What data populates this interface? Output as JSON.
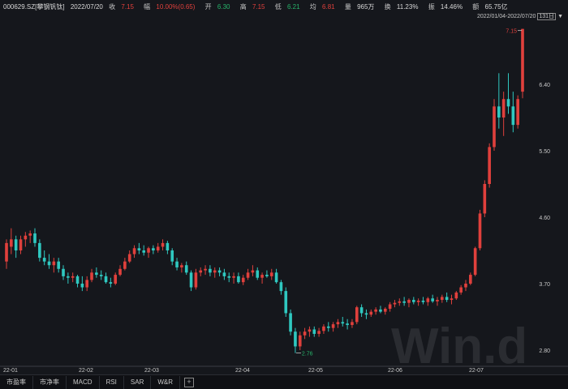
{
  "header": {
    "security": "000629.SZ[攀钢钒钛]",
    "date": "2022/07/20",
    "close_label": "收",
    "close": "7.15",
    "chg_label": "幅",
    "chg": "10.00%(0.65)",
    "open_label": "开",
    "open": "6.30",
    "high_label": "高",
    "high": "7.15",
    "low_label": "低",
    "low": "6.21",
    "prev_label": "均",
    "prev": "6.81",
    "vol_label": "量",
    "vol": "965万",
    "turn_label": "换",
    "turn": "11.23%",
    "amp_label": "振",
    "amp": "14.46%",
    "amt_label": "额",
    "amt": "65.75亿"
  },
  "range": {
    "text": "2022/01/04-2022/07/20",
    "count": "131日"
  },
  "watermark": "Win.d",
  "tabs": [
    "市盈率",
    "市净率",
    "MACD",
    "RSI",
    "SAR",
    "W&R"
  ],
  "tab_add": "+",
  "colors": {
    "up": "#e0403c",
    "down": "#2fc8c0",
    "bg": "#15171c"
  },
  "chart_data": {
    "type": "candlestick",
    "y_ticks": [
      "6.40",
      "5.50",
      "4.60",
      "3.70",
      "2.80"
    ],
    "x_ticks": [
      "22-01",
      "22-02",
      "22-03",
      "22-04",
      "22-05",
      "22-06",
      "22-07"
    ],
    "max_label": "7.15",
    "min_label": "2.76",
    "ohlc": [
      [
        4.0,
        4.3,
        3.9,
        4.25
      ],
      [
        4.2,
        4.45,
        4.1,
        4.3
      ],
      [
        4.3,
        4.35,
        4.05,
        4.15
      ],
      [
        4.15,
        4.35,
        4.1,
        4.3
      ],
      [
        4.3,
        4.4,
        4.2,
        4.35
      ],
      [
        4.35,
        4.42,
        4.25,
        4.38
      ],
      [
        4.38,
        4.45,
        4.2,
        4.25
      ],
      [
        4.25,
        4.3,
        4.0,
        4.05
      ],
      [
        4.05,
        4.15,
        3.95,
        4.0
      ],
      [
        4.0,
        4.1,
        3.9,
        3.95
      ],
      [
        3.95,
        4.05,
        3.85,
        4.0
      ],
      [
        4.0,
        4.05,
        3.85,
        3.9
      ],
      [
        3.9,
        3.95,
        3.75,
        3.8
      ],
      [
        3.8,
        3.85,
        3.7,
        3.78
      ],
      [
        3.78,
        3.85,
        3.72,
        3.8
      ],
      [
        3.8,
        3.82,
        3.65,
        3.7
      ],
      [
        3.7,
        3.8,
        3.6,
        3.65
      ],
      [
        3.65,
        3.8,
        3.6,
        3.75
      ],
      [
        3.75,
        3.9,
        3.72,
        3.85
      ],
      [
        3.85,
        3.92,
        3.78,
        3.82
      ],
      [
        3.82,
        3.88,
        3.75,
        3.8
      ],
      [
        3.8,
        3.85,
        3.7,
        3.72
      ],
      [
        3.72,
        3.78,
        3.65,
        3.7
      ],
      [
        3.7,
        3.85,
        3.68,
        3.82
      ],
      [
        3.82,
        3.95,
        3.8,
        3.9
      ],
      [
        3.9,
        4.05,
        3.88,
        4.0
      ],
      [
        4.0,
        4.15,
        3.98,
        4.1
      ],
      [
        4.1,
        4.22,
        4.05,
        4.18
      ],
      [
        4.18,
        4.25,
        4.1,
        4.15
      ],
      [
        4.15,
        4.22,
        4.08,
        4.12
      ],
      [
        4.12,
        4.2,
        4.05,
        4.18
      ],
      [
        4.18,
        4.22,
        4.1,
        4.15
      ],
      [
        4.15,
        4.25,
        4.12,
        4.2
      ],
      [
        4.2,
        4.3,
        4.15,
        4.25
      ],
      [
        4.25,
        4.28,
        4.1,
        4.15
      ],
      [
        4.15,
        4.18,
        3.95,
        4.0
      ],
      [
        4.0,
        4.05,
        3.88,
        3.92
      ],
      [
        3.92,
        3.98,
        3.85,
        3.95
      ],
      [
        3.95,
        4.0,
        3.82,
        3.85
      ],
      [
        3.85,
        3.88,
        3.6,
        3.65
      ],
      [
        3.65,
        3.9,
        3.62,
        3.85
      ],
      [
        3.85,
        3.92,
        3.8,
        3.88
      ],
      [
        3.88,
        3.95,
        3.82,
        3.9
      ],
      [
        3.9,
        3.95,
        3.8,
        3.85
      ],
      [
        3.85,
        3.92,
        3.78,
        3.88
      ],
      [
        3.88,
        3.92,
        3.8,
        3.85
      ],
      [
        3.85,
        3.9,
        3.75,
        3.8
      ],
      [
        3.8,
        3.85,
        3.72,
        3.78
      ],
      [
        3.78,
        3.85,
        3.7,
        3.8
      ],
      [
        3.8,
        3.85,
        3.7,
        3.72
      ],
      [
        3.72,
        3.82,
        3.68,
        3.78
      ],
      [
        3.78,
        3.9,
        3.75,
        3.85
      ],
      [
        3.85,
        3.95,
        3.8,
        3.88
      ],
      [
        3.88,
        3.92,
        3.75,
        3.78
      ],
      [
        3.78,
        3.85,
        3.7,
        3.82
      ],
      [
        3.82,
        3.88,
        3.78,
        3.8
      ],
      [
        3.8,
        3.9,
        3.75,
        3.85
      ],
      [
        3.85,
        3.9,
        3.7,
        3.72
      ],
      [
        3.72,
        3.75,
        3.55,
        3.6
      ],
      [
        3.6,
        3.65,
        3.25,
        3.3
      ],
      [
        3.3,
        3.35,
        3.0,
        3.05
      ],
      [
        3.05,
        3.1,
        2.76,
        2.85
      ],
      [
        2.85,
        3.05,
        2.8,
        3.0
      ],
      [
        3.0,
        3.1,
        2.95,
        3.05
      ],
      [
        3.05,
        3.12,
        2.98,
        3.08
      ],
      [
        3.08,
        3.12,
        2.98,
        3.02
      ],
      [
        3.02,
        3.1,
        2.98,
        3.06
      ],
      [
        3.06,
        3.15,
        3.02,
        3.12
      ],
      [
        3.12,
        3.18,
        3.05,
        3.1
      ],
      [
        3.1,
        3.18,
        3.05,
        3.15
      ],
      [
        3.15,
        3.22,
        3.1,
        3.18
      ],
      [
        3.18,
        3.25,
        3.12,
        3.16
      ],
      [
        3.16,
        3.22,
        3.08,
        3.14
      ],
      [
        3.14,
        3.22,
        3.1,
        3.18
      ],
      [
        3.18,
        3.4,
        3.15,
        3.38
      ],
      [
        3.38,
        3.42,
        3.25,
        3.3
      ],
      [
        3.3,
        3.35,
        3.22,
        3.28
      ],
      [
        3.28,
        3.35,
        3.25,
        3.32
      ],
      [
        3.32,
        3.38,
        3.28,
        3.35
      ],
      [
        3.35,
        3.4,
        3.3,
        3.32
      ],
      [
        3.32,
        3.38,
        3.28,
        3.36
      ],
      [
        3.36,
        3.45,
        3.32,
        3.42
      ],
      [
        3.42,
        3.48,
        3.38,
        3.44
      ],
      [
        3.44,
        3.5,
        3.4,
        3.46
      ],
      [
        3.46,
        3.52,
        3.4,
        3.44
      ],
      [
        3.44,
        3.5,
        3.38,
        3.48
      ],
      [
        3.48,
        3.52,
        3.42,
        3.45
      ],
      [
        3.45,
        3.5,
        3.4,
        3.47
      ],
      [
        3.47,
        3.52,
        3.42,
        3.45
      ],
      [
        3.45,
        3.52,
        3.4,
        3.5
      ],
      [
        3.5,
        3.55,
        3.44,
        3.46
      ],
      [
        3.46,
        3.52,
        3.4,
        3.48
      ],
      [
        3.48,
        3.55,
        3.44,
        3.52
      ],
      [
        3.52,
        3.58,
        3.45,
        3.48
      ],
      [
        3.48,
        3.55,
        3.42,
        3.5
      ],
      [
        3.5,
        3.6,
        3.48,
        3.58
      ],
      [
        3.58,
        3.68,
        3.55,
        3.65
      ],
      [
        3.65,
        3.75,
        3.6,
        3.7
      ],
      [
        3.7,
        3.85,
        3.68,
        3.82
      ],
      [
        3.82,
        4.2,
        3.8,
        4.18
      ],
      [
        4.18,
        4.7,
        4.15,
        4.65
      ],
      [
        4.65,
        5.1,
        4.6,
        5.05
      ],
      [
        5.05,
        5.6,
        5.0,
        5.55
      ],
      [
        5.55,
        6.2,
        5.5,
        6.1
      ],
      [
        6.1,
        6.55,
        5.8,
        5.95
      ],
      [
        5.95,
        6.3,
        5.7,
        6.2
      ],
      [
        6.2,
        6.55,
        6.0,
        6.1
      ],
      [
        6.1,
        6.3,
        5.75,
        5.85
      ],
      [
        5.85,
        6.25,
        5.8,
        6.2
      ],
      [
        6.3,
        7.15,
        6.21,
        7.15
      ]
    ]
  }
}
